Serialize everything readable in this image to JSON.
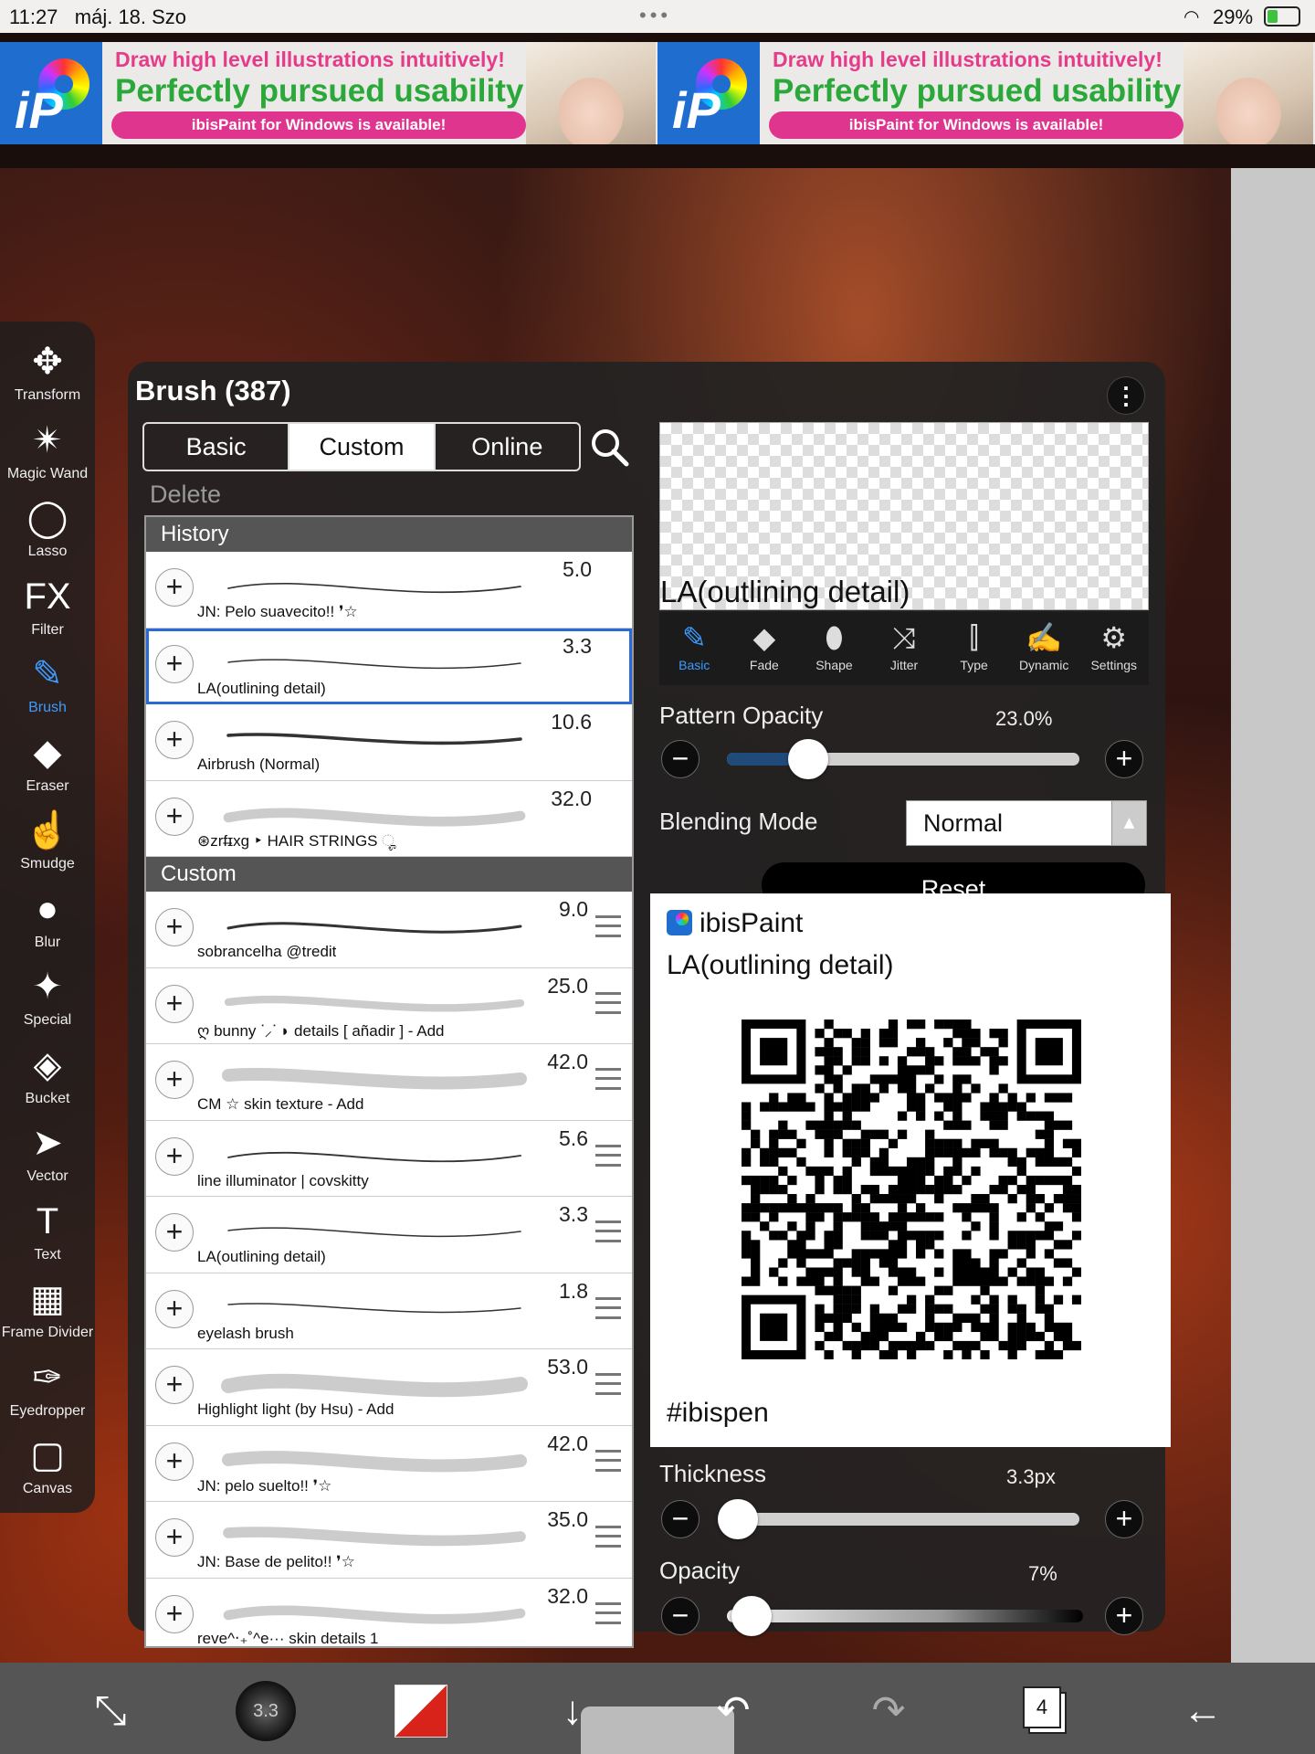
{
  "status_bar": {
    "time": "11:27",
    "date": "máj. 18. Szo",
    "battery": "29%"
  },
  "ad": {
    "line1": "Draw high level illustrations intuitively!",
    "line2": "Perfectly pursued usability!",
    "line3": "ibisPaint for Windows is available!",
    "logo": "iP"
  },
  "tools": [
    {
      "label": "Transform",
      "icon": "✥"
    },
    {
      "label": "Magic Wand",
      "icon": "✴"
    },
    {
      "label": "Lasso",
      "icon": "◯"
    },
    {
      "label": "Filter",
      "icon": "FX"
    },
    {
      "label": "Brush",
      "icon": "✎"
    },
    {
      "label": "Eraser",
      "icon": "◆"
    },
    {
      "label": "Smudge",
      "icon": "☝"
    },
    {
      "label": "Blur",
      "icon": "●"
    },
    {
      "label": "Special",
      "icon": "✦"
    },
    {
      "label": "Bucket",
      "icon": "◈"
    },
    {
      "label": "Vector",
      "icon": "➤"
    },
    {
      "label": "Text",
      "icon": "T"
    },
    {
      "label": "Frame Divider",
      "icon": "▦"
    },
    {
      "label": "Eyedropper",
      "icon": "✑"
    },
    {
      "label": "Canvas",
      "icon": "▢"
    }
  ],
  "panel": {
    "title": "Brush (387)",
    "tabs": [
      "Basic",
      "Custom",
      "Online"
    ],
    "delete_label": "Delete",
    "history_label": "History",
    "custom_label": "Custom",
    "history": [
      {
        "size": "5.0",
        "name": "JN: Pelo suavecito!! ❜☆"
      },
      {
        "size": "3.3",
        "name": "LA(outlining detail)"
      },
      {
        "size": "10.6",
        "name": "Airbrush (Normal)"
      },
      {
        "size": "32.0",
        "name": "⊛zrf̶ɪxg ‣ HAIR STRINGS ೄ"
      }
    ],
    "custom": [
      {
        "size": "9.0",
        "name": "sobrancelha @tredit"
      },
      {
        "size": "25.0",
        "name": "ღ bunny ᐝ⸝ᐝ ◗ details [ añadir ] - Add"
      },
      {
        "size": "42.0",
        "name": "CM ☆ skin texture - Add"
      },
      {
        "size": "5.6",
        "name": "line illuminator | covskitty"
      },
      {
        "size": "3.3",
        "name": "LA(outlining detail)"
      },
      {
        "size": "1.8",
        "name": "eyelash brush"
      },
      {
        "size": "53.0",
        "name": "Highlight light (by Hsu) - Add"
      },
      {
        "size": "42.0",
        "name": "JN: pelo suelto!! ❜☆"
      },
      {
        "size": "35.0",
        "name": "JN: Base de pelito!! ❜☆"
      },
      {
        "size": "32.0",
        "name": "reve^‧₊˚^e··· skin details 1"
      }
    ],
    "preview_name": "LA(outlining detail)",
    "subtabs": [
      {
        "label": "Basic",
        "icon": "✎"
      },
      {
        "label": "Fade",
        "icon": "◆"
      },
      {
        "label": "Shape",
        "icon": "⬮"
      },
      {
        "label": "Jitter",
        "icon": "⤨"
      },
      {
        "label": "Type",
        "icon": "⫿"
      },
      {
        "label": "Dynamic",
        "icon": "✍"
      },
      {
        "label": "Settings",
        "icon": "⚙"
      }
    ],
    "pattern_opacity": {
      "label": "Pattern Opacity",
      "value": "23.0%",
      "level": 0.23
    },
    "blending_mode": {
      "label": "Blending Mode",
      "value": "Normal"
    },
    "reset_label": "Reset",
    "thickness": {
      "label": "Thickness",
      "value": "3.3px",
      "level": 0.03
    },
    "opacity": {
      "label": "Opacity",
      "value": "7%",
      "level": 0.07
    }
  },
  "share": {
    "app_name": "ibisPaint",
    "brush_name": "LA(outlining detail)",
    "hashtag": "#ibispen"
  },
  "bottom": {
    "brush_size": "3.3",
    "layer_count": "4"
  }
}
